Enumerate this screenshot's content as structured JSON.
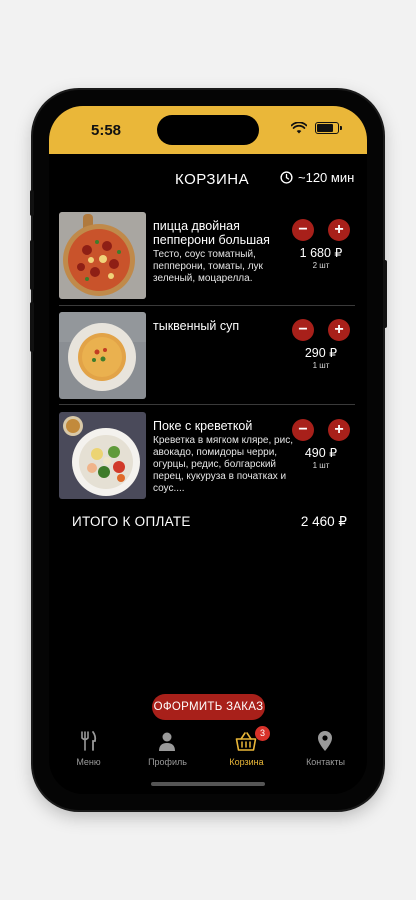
{
  "status_bar": {
    "time": "5:58",
    "bg_color": "#eab739"
  },
  "header": {
    "title": "КОРЗИНА",
    "eta": "~120 мин",
    "eta_icon": "clock-icon"
  },
  "cart": {
    "items": [
      {
        "name": "пицца двойная пепперони большая",
        "description": "Тесто, соус томатный, пепперони, томаты, лук зеленый, моцарелла.",
        "price": "1 680 ₽",
        "count": "2 шт",
        "image": "pizza-image"
      },
      {
        "name": "тыквенный суп",
        "description": "",
        "price": "290 ₽",
        "count": "1 шт",
        "image": "soup-image"
      },
      {
        "name": "Поке  с креветкой",
        "description": "Креветка в мягком кляре, рис, авокадо, помидоры черри, огурцы, редис, болгарский перец, кукуруза в початках и соус....",
        "price": "490 ₽",
        "count": "1 шт",
        "image": "poke-image"
      }
    ],
    "minus_label": "−",
    "plus_label": "+"
  },
  "total": {
    "label": "ИТОГО К ОПЛАТЕ",
    "value": "2 460 ₽"
  },
  "checkout_label": "ОФОРМИТЬ ЗАКАЗ",
  "tabs": [
    {
      "label": "Меню",
      "icon": "fork-knife-icon",
      "active": false
    },
    {
      "label": "Профиль",
      "icon": "user-icon",
      "active": false
    },
    {
      "label": "Корзина",
      "icon": "basket-icon",
      "active": true,
      "badge": "3"
    },
    {
      "label": "Контакты",
      "icon": "location-pin-icon",
      "active": false
    }
  ],
  "colors": {
    "accent": "#eab739",
    "button_red": "#a8201a",
    "background": "#000000"
  }
}
